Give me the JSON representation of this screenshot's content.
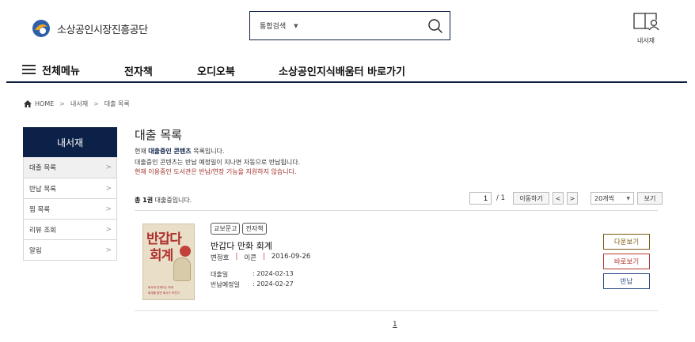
{
  "header": {
    "logo_text": "소상공인시장진흥공단",
    "search_type": "통합검색",
    "search_value": "",
    "mylib_label": "내서재"
  },
  "nav": {
    "all_menu": "전체메뉴",
    "items": [
      "전자책",
      "오디오북",
      "소상공인지식배움터 바로가기"
    ]
  },
  "breadcrumb": [
    "HOME",
    "내서재",
    "대출 목록"
  ],
  "sidebar": {
    "title": "내서재",
    "items": [
      {
        "label": "대출 목록"
      },
      {
        "label": "반납 목록"
      },
      {
        "label": "찜 목록"
      },
      {
        "label": "리뷰 조회"
      },
      {
        "label": "알림"
      }
    ]
  },
  "main": {
    "title": "대출 목록",
    "desc1_pre": "현재 ",
    "desc1_bold": "대출중인 콘텐츠",
    "desc1_post": " 목록입니다.",
    "desc2": "대출중인 콘텐츠는 반납 예정일이 지나면 자동으로 반납됩니다.",
    "desc3": "현재 이용중인 도서관은 반납/연장 기능을 지원하지 않습니다.",
    "count_bold": "총 1권",
    "count_rest": " 대출중입니다.",
    "pager": {
      "current": "1",
      "total": "/ 1",
      "go_label": "이동하기",
      "prev": "<",
      "next": ">",
      "per_page": "20개씩",
      "view_label": "보기"
    }
  },
  "book": {
    "cover_line1": "반갑다",
    "cover_line2": "회계",
    "cover_sub1": "회사와 친해지는 회계",
    "cover_sub2": "회계를 알면 회사가 보인다",
    "tags": [
      "교보문고",
      "전자책"
    ],
    "title": "반갑다 만화 회계",
    "author": "변정호",
    "publisher": "이콘",
    "date": "2016-09-26",
    "loan_label": "대출일",
    "loan_date": ": 2024-02-13",
    "due_label": "반납예정일",
    "due_date": ": 2024-02-27",
    "btn_download": "다운보기",
    "btn_view": "바로보기",
    "btn_return": "반납"
  },
  "pagination": {
    "page": "1"
  },
  "colors": {
    "navy": "#0c2147",
    "red": "#a0302a"
  }
}
